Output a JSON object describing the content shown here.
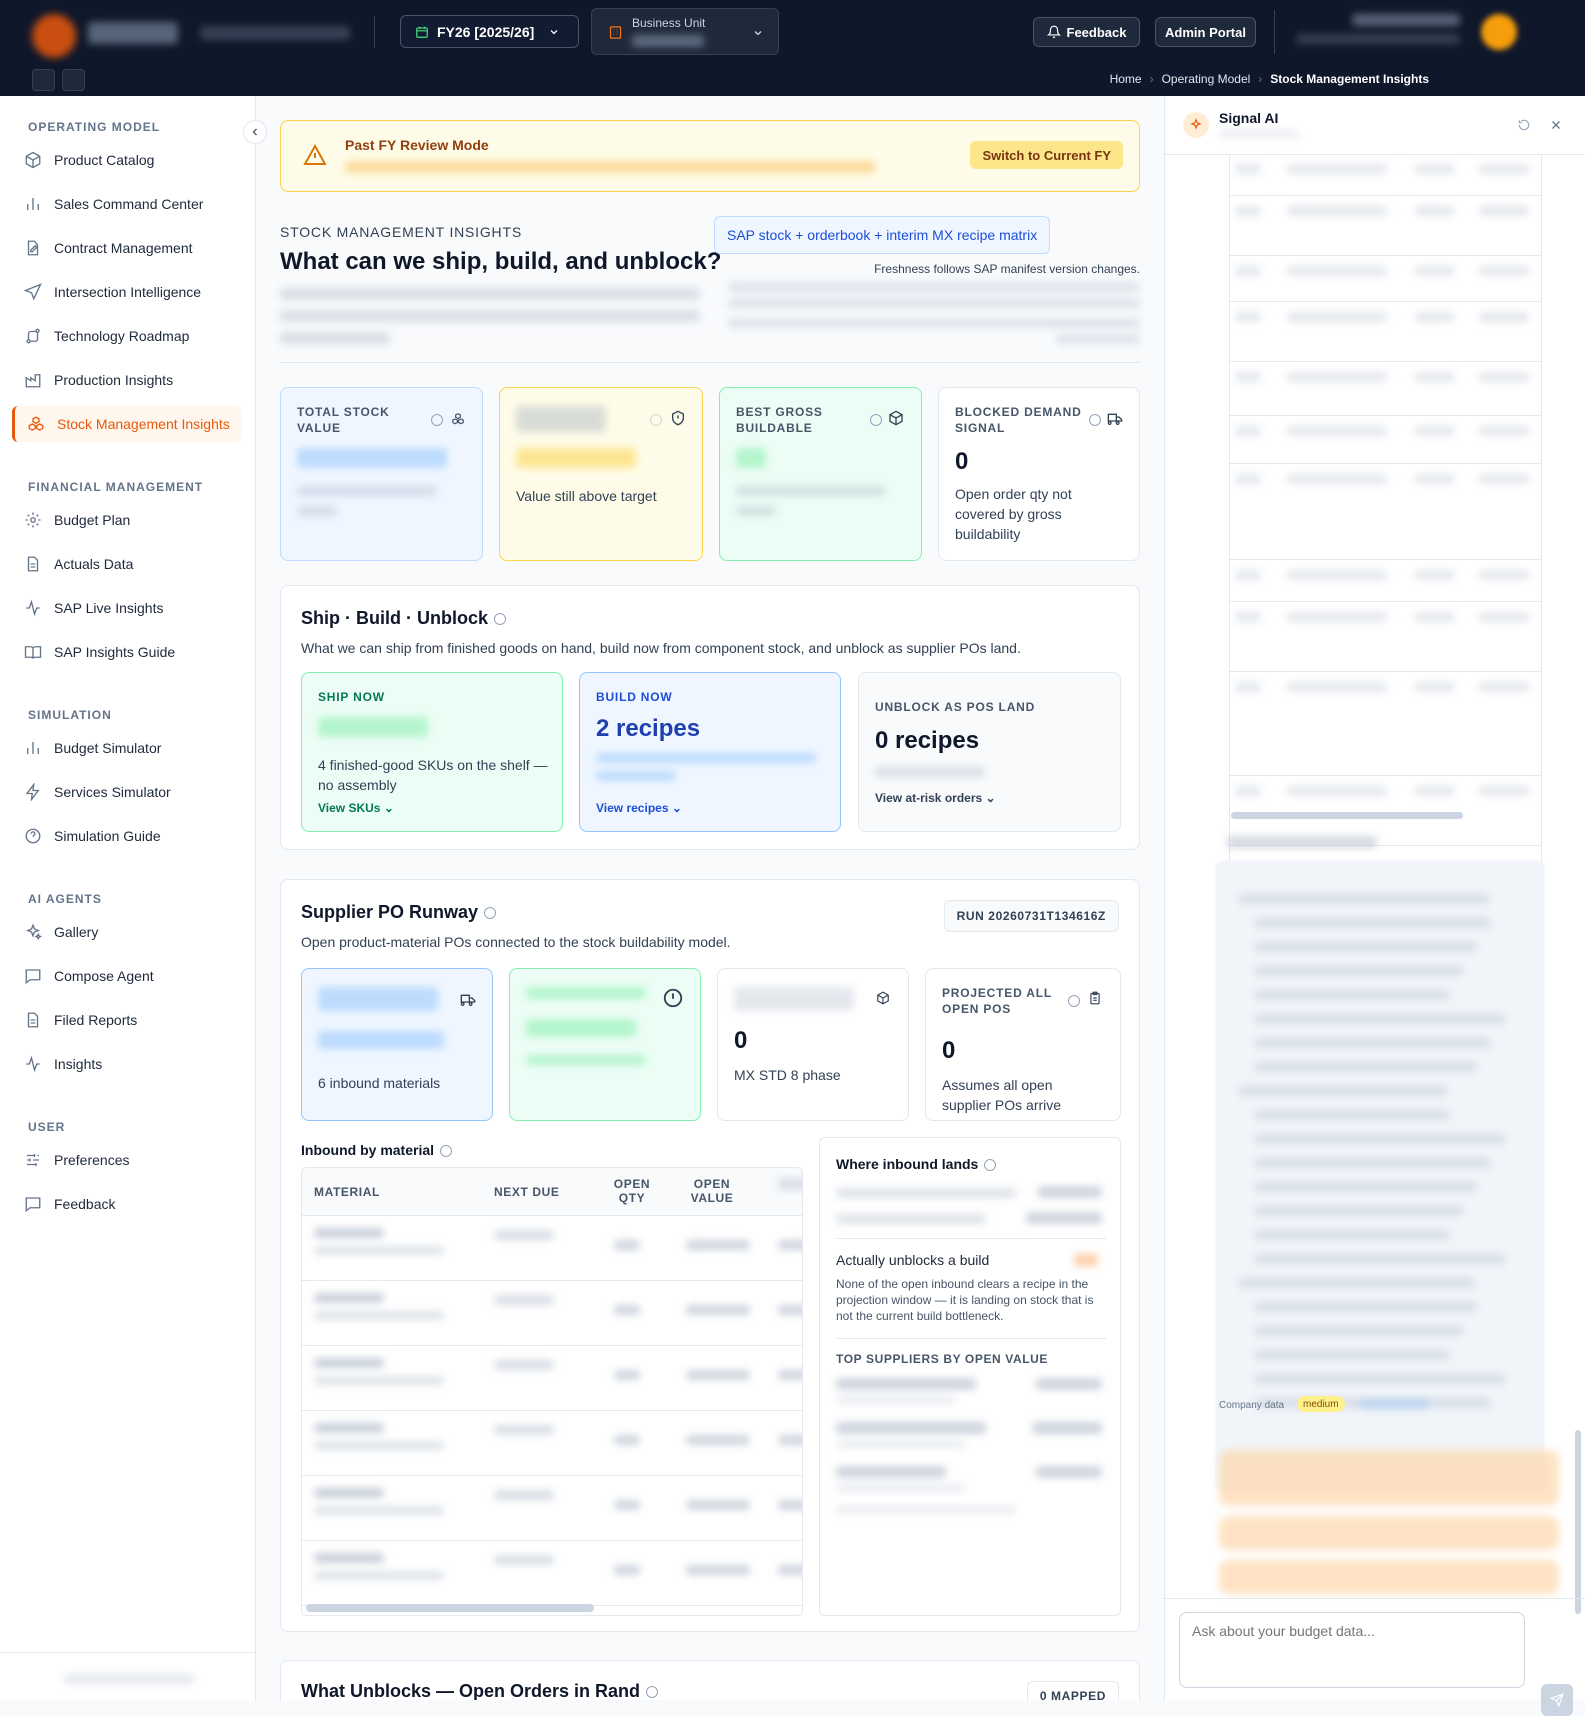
{
  "topbar": {
    "fiscal_year": "FY26 [2025/26]",
    "business_unit_label": "Business Unit",
    "feedback_label": "Feedback",
    "admin_portal_label": "Admin Portal"
  },
  "breadcrumb": {
    "home": "Home",
    "section": "Operating Model",
    "current": "Stock Management Insights"
  },
  "sidebar": {
    "operating_model": {
      "heading": "OPERATING MODEL",
      "items": [
        "Product Catalog",
        "Sales Command Center",
        "Contract Management",
        "Intersection Intelligence",
        "Technology Roadmap",
        "Production Insights",
        "Stock Management Insights"
      ]
    },
    "financial_management": {
      "heading": "FINANCIAL MANAGEMENT",
      "items": [
        "Budget Plan",
        "Actuals Data",
        "SAP Live Insights",
        "SAP Insights Guide"
      ]
    },
    "simulation": {
      "heading": "SIMULATION",
      "items": [
        "Budget Simulator",
        "Services Simulator",
        "Simulation Guide"
      ]
    },
    "ai_agents": {
      "heading": "AI AGENTS",
      "items": [
        "Gallery",
        "Compose Agent",
        "Filed Reports",
        "Insights"
      ]
    },
    "user": {
      "heading": "USER",
      "items": [
        "Preferences",
        "Feedback"
      ]
    }
  },
  "banner": {
    "title": "Past FY Review Mode",
    "button": "Switch to Current FY"
  },
  "header": {
    "eyebrow": "STOCK MANAGEMENT INSIGHTS",
    "title": "What can we ship, build, and unblock?",
    "source_chip": "SAP stock + orderbook + interim MX recipe matrix",
    "freshness": "Freshness follows SAP manifest version changes."
  },
  "kpis": [
    {
      "label": "TOTAL STOCK VALUE",
      "desc": ""
    },
    {
      "label": "",
      "desc": "Value still above target"
    },
    {
      "label": "BEST GROSS BUILDABLE",
      "desc": ""
    },
    {
      "label": "BLOCKED DEMAND SIGNAL",
      "value": "0",
      "desc": "Open order qty not covered by gross buildability"
    }
  ],
  "sbu": {
    "title": "Ship · Build · Unblock",
    "subtitle": "What we can ship from finished goods on hand, build now from component stock, and unblock as supplier POs land.",
    "ship": {
      "label": "SHIP NOW",
      "desc": "4 finished-good SKUs on the shelf — no assembly",
      "link": "View SKUs"
    },
    "build": {
      "label": "BUILD NOW",
      "value": "2 recipes",
      "link": "View recipes"
    },
    "unblock": {
      "label": "UNBLOCK AS POS LAND",
      "value": "0 recipes",
      "link": "View at-risk orders"
    }
  },
  "runway": {
    "title": "Supplier PO Runway",
    "subtitle": "Open product-material POs connected to the stock buildability model.",
    "run_id": "RUN 20260731T134616Z",
    "k1_desc": "6 inbound materials",
    "k3": {
      "value": "0",
      "desc": "MX STD 8 phase"
    },
    "k4": {
      "label": "PROJECTED ALL OPEN POS",
      "value": "0",
      "desc": "Assumes all open supplier POs arrive"
    },
    "inbound_title": "Inbound by material",
    "columns": [
      "MATERIAL",
      "NEXT DUE",
      "OPEN QTY",
      "OPEN VALUE"
    ],
    "where_title": "Where inbound lands",
    "unblocks_title": "Actually unblocks a build",
    "unblocks_desc": "None of the open inbound clears a recipe in the projection window — it is landing on stock that is not the current build bottleneck.",
    "top_suppliers": "TOP SUPPLIERS BY OPEN VALUE"
  },
  "next_section": {
    "title": "What Unblocks — Open Orders in Rand",
    "badge": "0 MAPPED"
  },
  "signal_ai": {
    "title": "Signal AI",
    "company_data": "Company data",
    "confidence": "medium",
    "input_placeholder": "Ask about your budget data..."
  }
}
